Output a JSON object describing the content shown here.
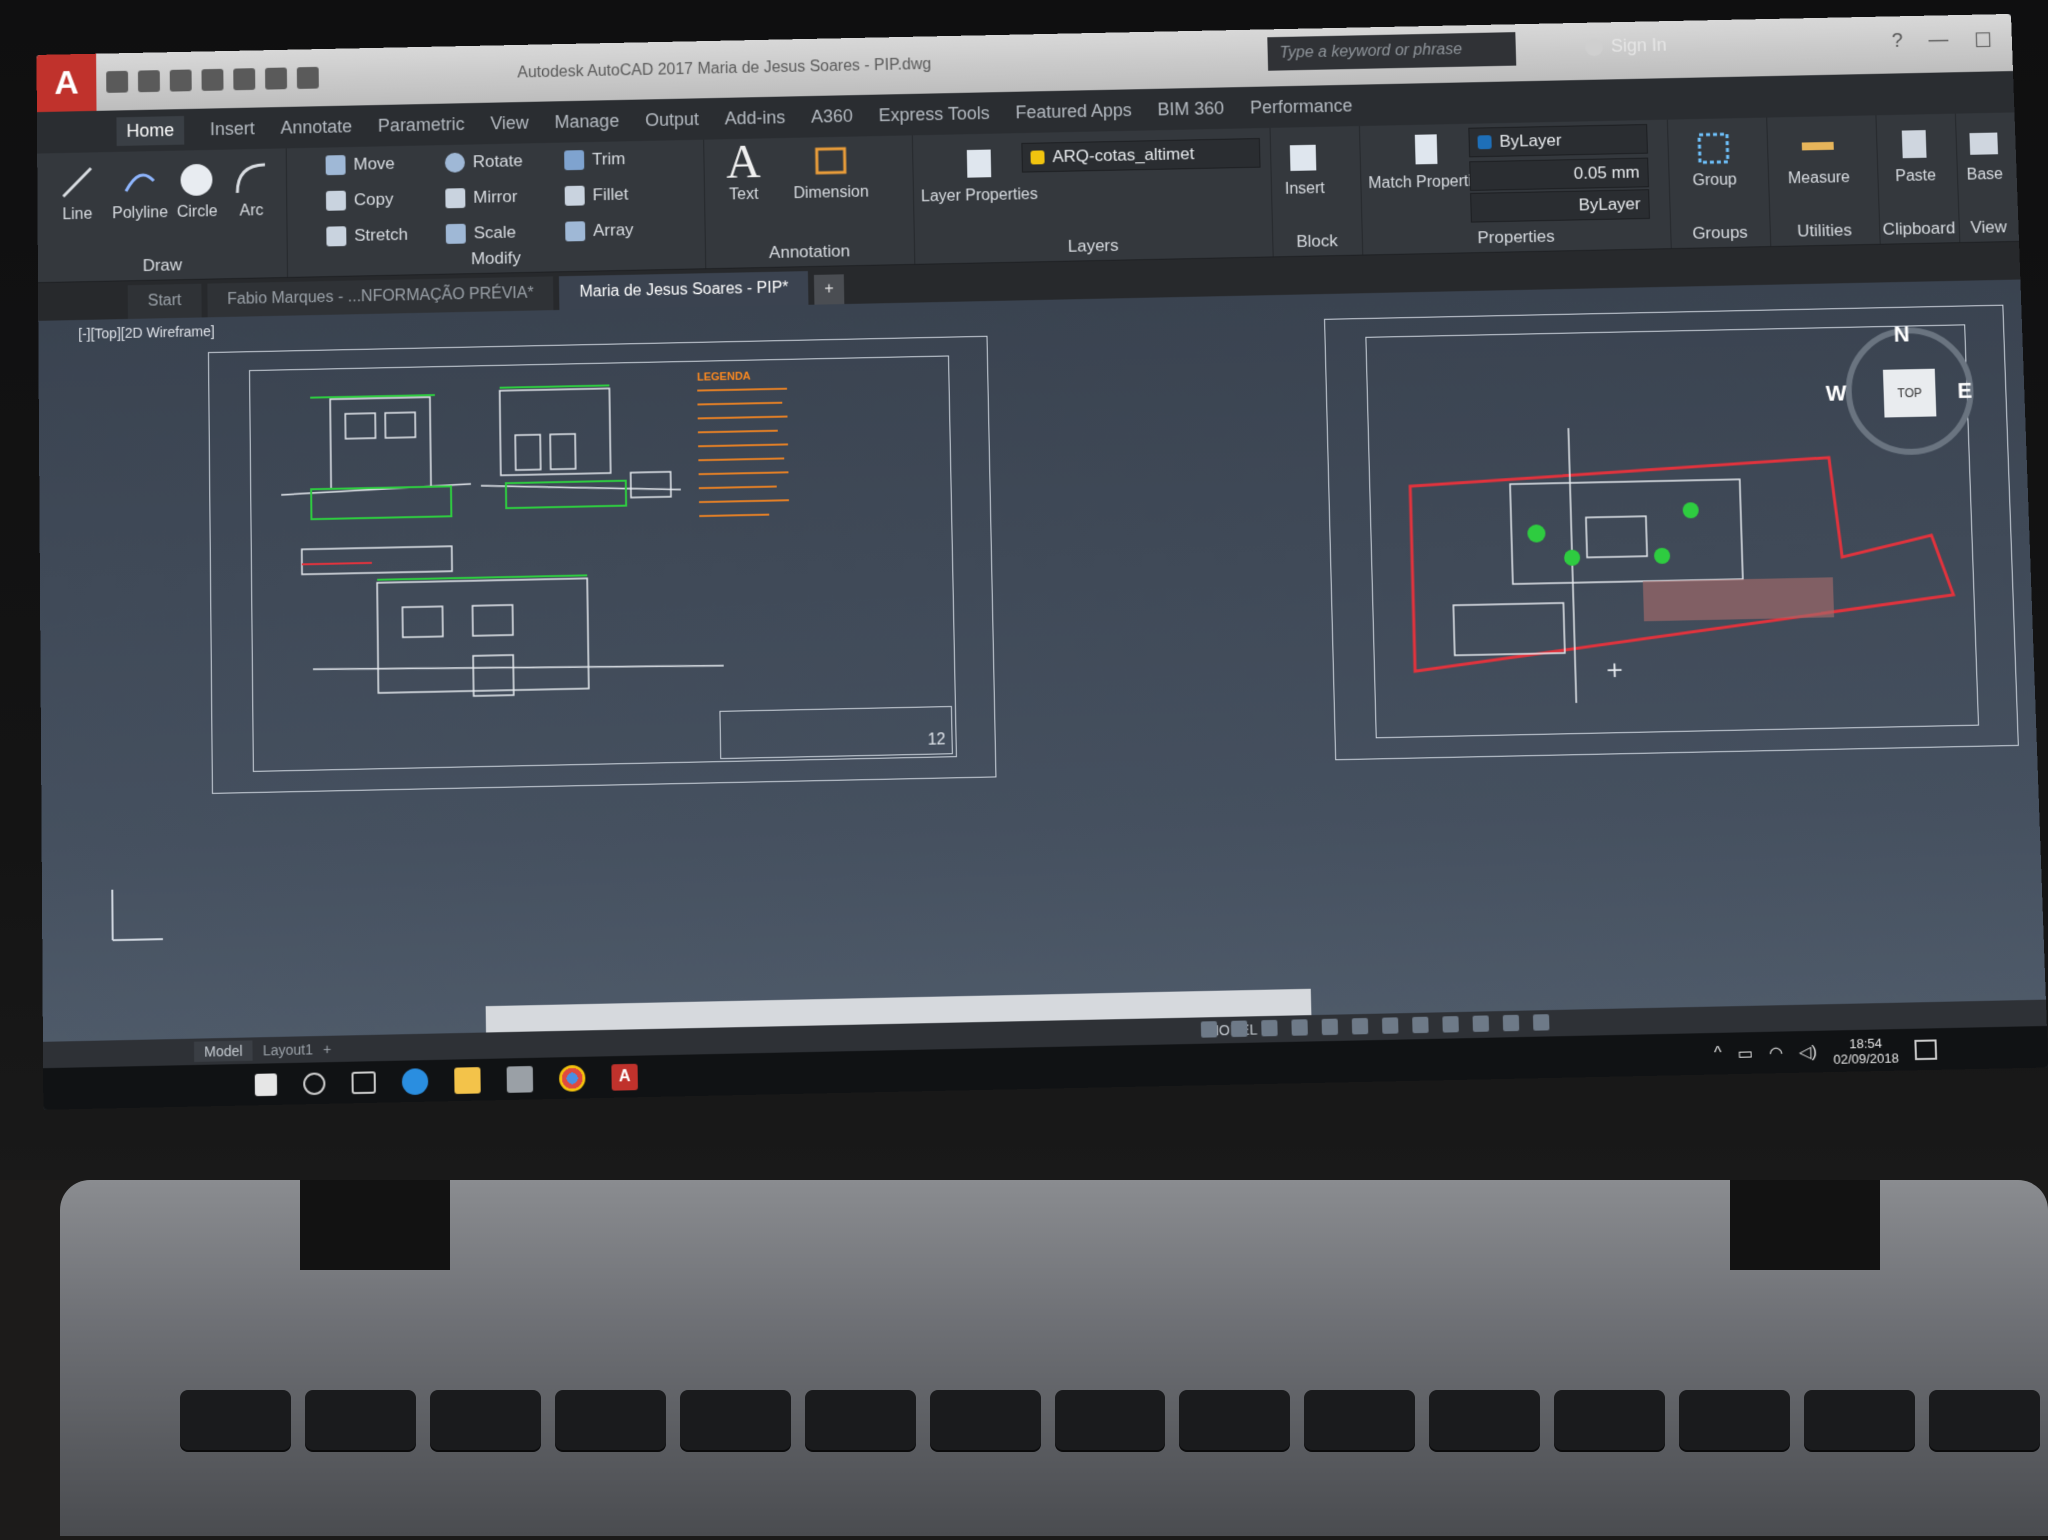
{
  "window": {
    "title": "Autodesk AutoCAD 2017   Maria de Jesus Soares - PIP.dwg",
    "search_placeholder": "Type a keyword or phrase",
    "sign_in": "Sign In"
  },
  "ribbon_tabs": [
    "Home",
    "Insert",
    "Annotate",
    "Parametric",
    "View",
    "Manage",
    "Output",
    "Add-ins",
    "A360",
    "Express Tools",
    "Featured Apps",
    "BIM 360",
    "Performance"
  ],
  "draw": {
    "label": "Draw",
    "line": "Line",
    "polyline": "Polyline",
    "circle": "Circle",
    "arc": "Arc"
  },
  "modify": {
    "label": "Modify",
    "move": "Move",
    "rotate": "Rotate",
    "trim": "Trim",
    "copy": "Copy",
    "mirror": "Mirror",
    "fillet": "Fillet",
    "stretch": "Stretch",
    "scale": "Scale",
    "array": "Array"
  },
  "annotation": {
    "label": "Annotation",
    "text": "Text",
    "dimension": "Dimension"
  },
  "layers": {
    "label": "Layers",
    "layer_properties": "Layer Properties",
    "current_layer": "ARQ-cotas_altimet"
  },
  "block": {
    "label": "Block",
    "insert": "Insert"
  },
  "properties": {
    "label": "Properties",
    "match": "Match Properties",
    "color": "ByLayer",
    "lineweight": "0.05 mm",
    "linetype": "ByLayer"
  },
  "groups": {
    "label": "Groups",
    "group": "Group"
  },
  "utilities": {
    "label": "Utilities",
    "measure": "Measure"
  },
  "clipboard": {
    "label": "Clipboard",
    "paste": "Paste"
  },
  "view": {
    "label": "View",
    "base": "Base"
  },
  "doc_tabs": [
    "Start",
    "Fabio Marques - ...NFORMAÇÃO PRÉVIA*",
    "Maria de Jesus Soares - PIP*"
  ],
  "viewport": {
    "label": "[-][Top][2D Wireframe]",
    "legend_title": "LEGENDA",
    "sheet_number": "12"
  },
  "viewcube": {
    "n": "N",
    "w": "W",
    "e": "E",
    "top": "TOP"
  },
  "status": {
    "model": "Model",
    "layout": "Layout1",
    "mode": "MODEL"
  },
  "clock": {
    "time": "18:54",
    "date": "02/09/2018"
  },
  "colors": {
    "accent": "#c0322c",
    "legend": "#ff8a1f",
    "drawing_green": "#2ecc40",
    "site_red": "#e2333d"
  }
}
